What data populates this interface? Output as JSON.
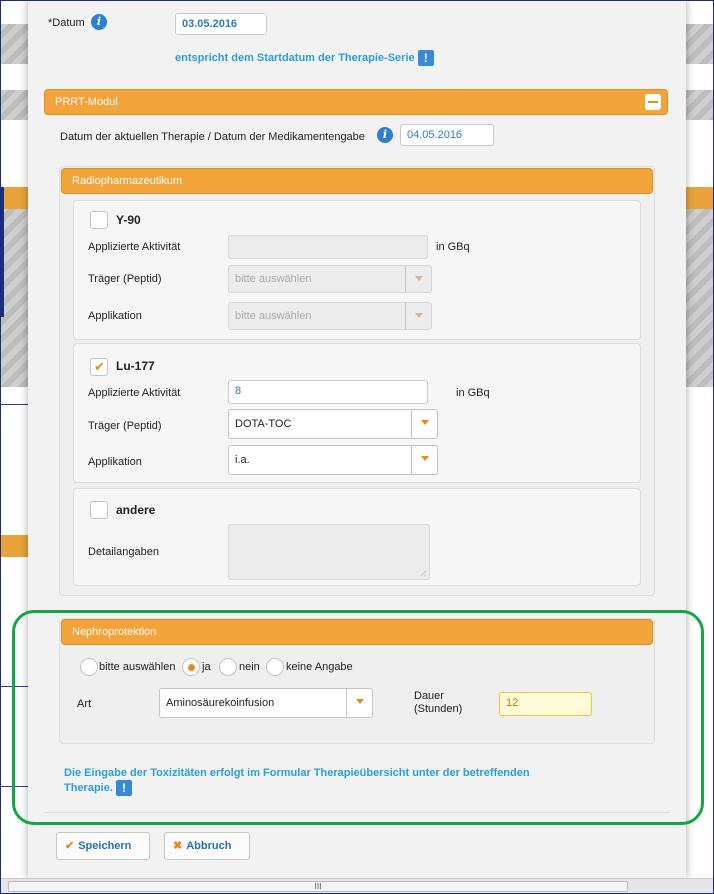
{
  "header": {
    "datum_label": "*Datum",
    "datum_value": "03.05.2016",
    "datum_hint": "entspricht dem Startdatum der Therapie-Serie"
  },
  "prrt": {
    "title": "PRRT-Modul",
    "therapy_date_label": "Datum der aktuellen Therapie / Datum der Medikamentengabe",
    "therapy_date_value": "04.05.2016"
  },
  "radio": {
    "title": "Radiopharmazeutikum",
    "y90": {
      "name": "Y-90",
      "checked": false,
      "activity_label": "Applizierte Aktivität",
      "activity_value": "",
      "unit": "in GBq",
      "carrier_label": "Träger (Peptid)",
      "carrier_value": "bitte auswählen",
      "application_label": "Applikation",
      "application_value": "bitte auswählen"
    },
    "lu177": {
      "name": "Lu-177",
      "checked": true,
      "activity_label": "Applizierte Aktivität",
      "activity_value": "8",
      "unit": "in GBq",
      "carrier_label": "Träger (Peptid)",
      "carrier_value": "DOTA-TOC",
      "application_label": "Applikation",
      "application_value": "i.a."
    },
    "other": {
      "name": "andere",
      "checked": false,
      "details_label": "Detailangaben"
    }
  },
  "nephro": {
    "title": "Nephroprotektion",
    "options": [
      "bitte auswählen",
      "ja",
      "nein",
      "keine Angabe"
    ],
    "selected": "ja",
    "art_label": "Art",
    "art_value": "Aminosäurekoinfusion",
    "dauer_label_1": "Dauer",
    "dauer_label_2": "(Stunden)",
    "dauer_value": "12"
  },
  "note": {
    "line1": "Die Eingabe der Toxizitäten erfolgt im Formular Therapieübersicht unter der betreffenden",
    "line2": "Therapie."
  },
  "buttons": {
    "save": "Speichern",
    "cancel": "Abbruch"
  },
  "scrollbar": {
    "thumb_label": "III"
  },
  "colors": {
    "accent_orange": "#f2a33a",
    "link_blue": "#2b9fd6",
    "highlight_green": "#17a34a"
  }
}
